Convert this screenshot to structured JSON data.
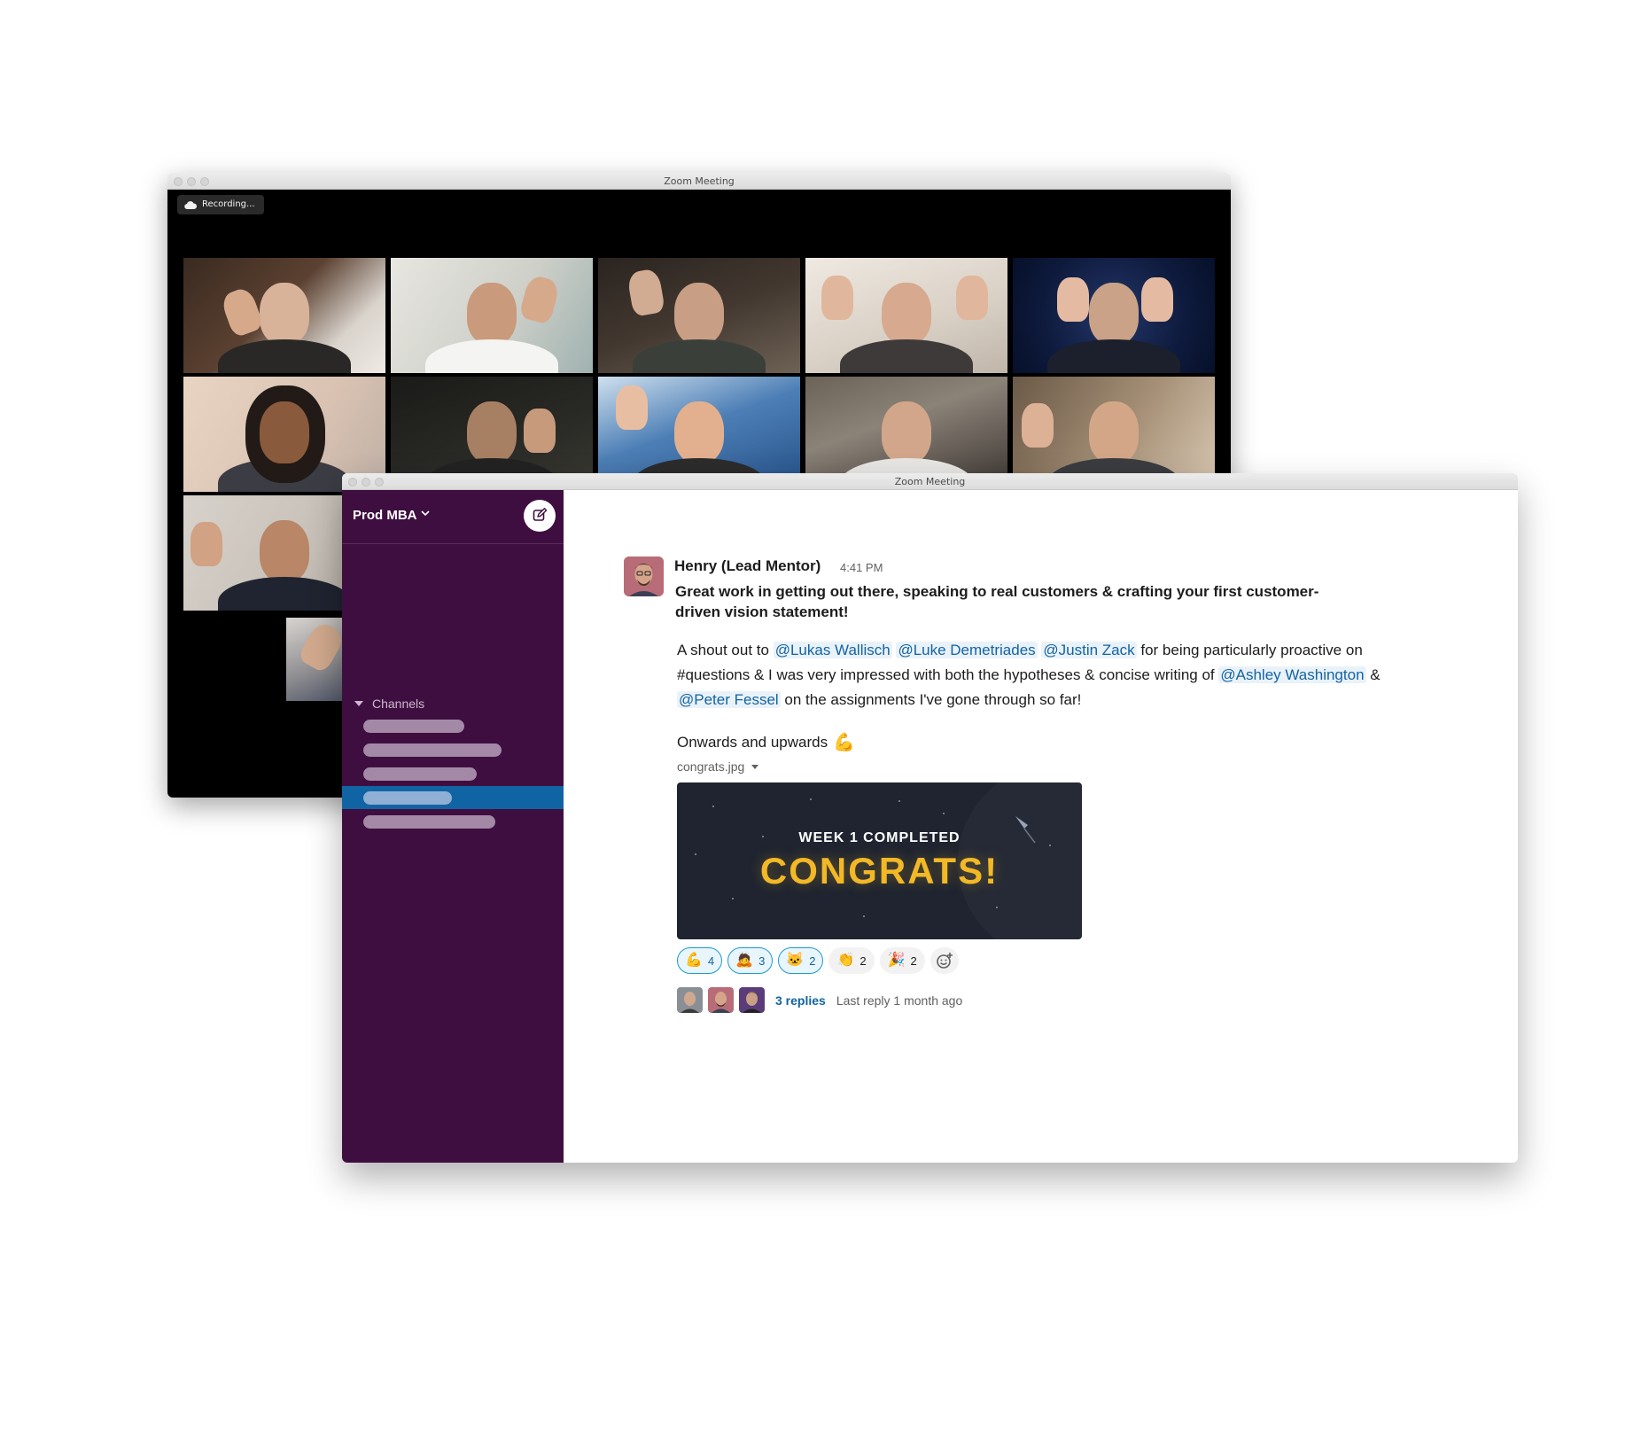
{
  "zoom": {
    "title": "Zoom Meeting",
    "recording_label": "Recording..."
  },
  "slack": {
    "title": "Zoom Meeting",
    "workspace": "Prod MBA",
    "channels_label": "Channels",
    "message": {
      "author": "Henry (Lead Mentor)",
      "time": "4:41 PM",
      "headline": "Great work in getting out there, speaking to real customers & crafting your first customer-driven vision statement!",
      "body": {
        "t1": "A shout out to",
        "m1": "@Lukas Wallisch",
        "m2": "@Luke Demetriades",
        "m3": "@Justin Zack",
        "t2": "for being particularly proactive on #questions & I was very impressed with both the hypotheses & concise writing of",
        "m4": "@Ashley Washington",
        "t3": "&",
        "m5": "@Peter Fessel",
        "t4": "on the assignments I've gone through so far!"
      },
      "onwards": "Onwards and upwards",
      "onwards_emoji": "💪",
      "file_name": "congrats.jpg",
      "image": {
        "subtitle": "WEEK 1 COMPLETED",
        "title": "CONGRATS!"
      },
      "reactions": [
        {
          "emoji": "💪",
          "count": "4"
        },
        {
          "emoji": "🙇",
          "count": "3"
        },
        {
          "emoji": "🐱",
          "count": "2"
        },
        {
          "emoji": "👏",
          "count": "2"
        },
        {
          "emoji": "🎉",
          "count": "2"
        }
      ],
      "thread": {
        "replies": "3 replies",
        "last_reply": "Last reply 1 month ago"
      }
    }
  },
  "colors": {
    "sidebar": "#3f0e40",
    "active_channel": "#1164a3",
    "mention": "#1264a3",
    "congrats_gold": "#f2b826"
  }
}
